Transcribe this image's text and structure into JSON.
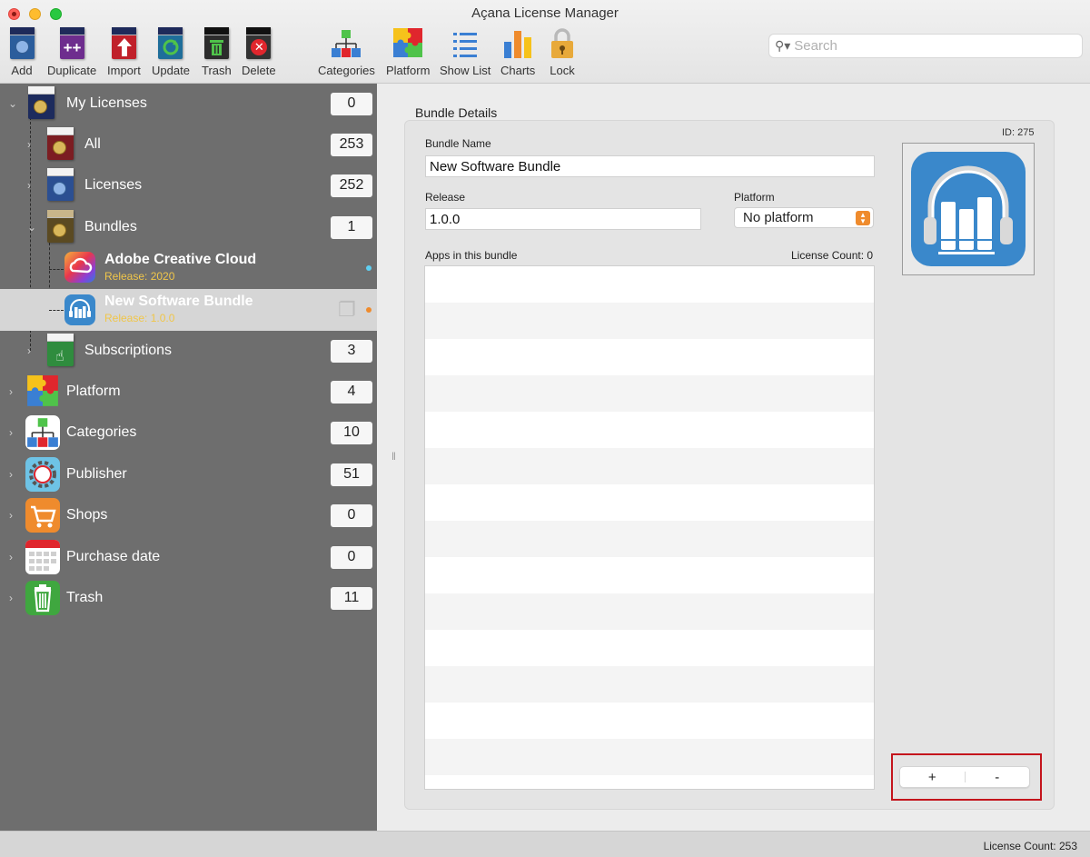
{
  "window": {
    "title": "Açana License Manager"
  },
  "toolbar": {
    "add": "Add",
    "duplicate": "Duplicate",
    "import": "Import",
    "update": "Update",
    "trash": "Trash",
    "delete": "Delete",
    "categories": "Categories",
    "platform": "Platform",
    "show_list": "Show List",
    "charts": "Charts",
    "lock": "Lock"
  },
  "search": {
    "placeholder": "Search"
  },
  "sidebar": {
    "my_licenses": {
      "label": "My Licenses",
      "count": "0"
    },
    "all": {
      "label": "All",
      "count": "253"
    },
    "licenses": {
      "label": "Licenses",
      "count": "252"
    },
    "bundles": {
      "label": "Bundles",
      "count": "1"
    },
    "bundle_items": [
      {
        "title": "Adobe Creative Cloud",
        "release": "Release: 2020"
      },
      {
        "title": "New Software Bundle",
        "release": "Release: 1.0.0"
      }
    ],
    "subscriptions": {
      "label": "Subscriptions",
      "count": "3"
    },
    "platform": {
      "label": "Platform",
      "count": "4"
    },
    "categories": {
      "label": "Categories",
      "count": "10"
    },
    "publisher": {
      "label": "Publisher",
      "count": "51"
    },
    "shops": {
      "label": "Shops",
      "count": "0"
    },
    "purchase_date": {
      "label": "Purchase date",
      "count": "0"
    },
    "trash": {
      "label": "Trash",
      "count": "11"
    }
  },
  "details": {
    "group_title": "Bundle Details",
    "bundle_name_label": "Bundle Name",
    "bundle_name_value": "New Software Bundle",
    "release_label": "Release",
    "release_value": "1.0.0",
    "platform_label": "Platform",
    "platform_value": "No platform",
    "apps_label": "Apps in this bundle",
    "license_count_label": "License Count: 0",
    "id_label": "ID: 275",
    "add_button": "+",
    "remove_button": "-"
  },
  "status": {
    "text": "License Count: 253"
  },
  "colors": {
    "sidebar_bg": "#6e6e6e",
    "selected_row_bg": "#d6d6d6",
    "release_text": "#f0c64a",
    "accent_orange": "#ef8b2d",
    "bundle_icon_bg": "#3a88cb",
    "highlight": "#c4141c"
  }
}
